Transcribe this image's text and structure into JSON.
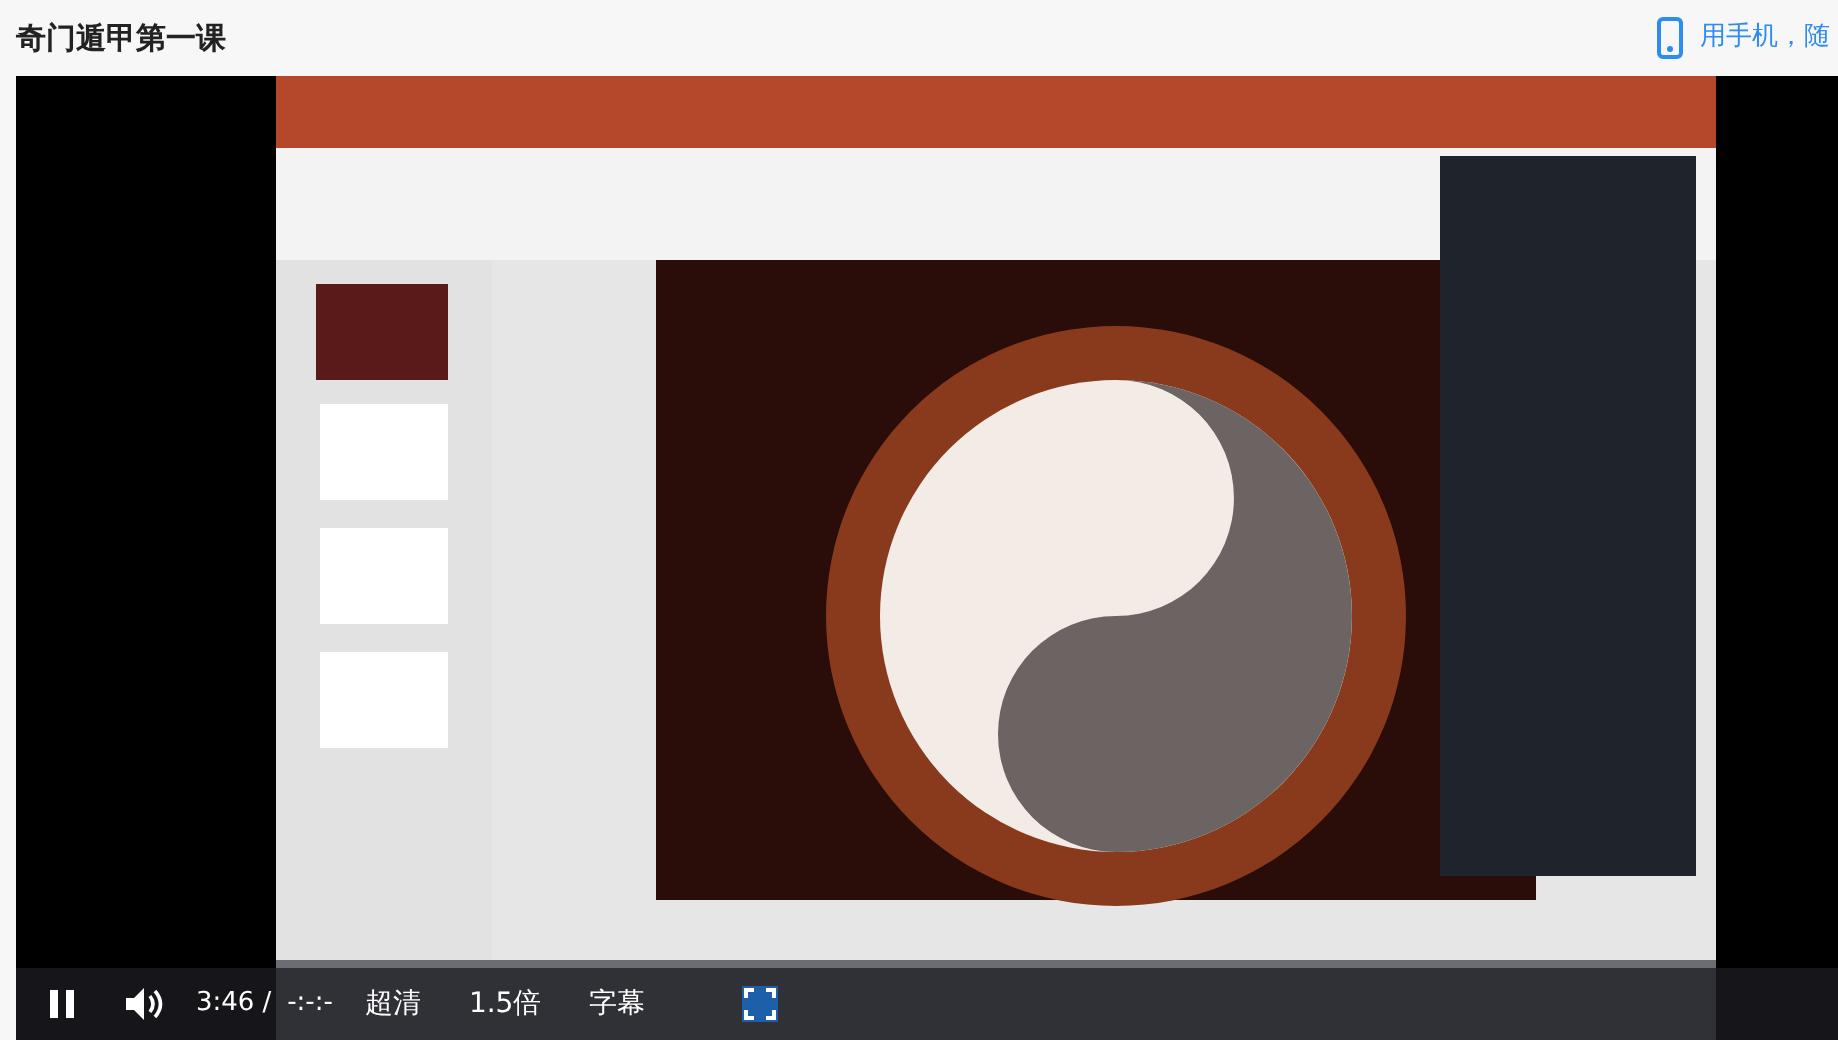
{
  "page": {
    "title": "奇门遁甲第一课",
    "mobile_link": "用手机，随"
  },
  "player": {
    "controls": {
      "playing": true,
      "current_time": "3:46",
      "separator": "/",
      "duration": "-:-:-",
      "quality": "超清",
      "speed": "1.5倍",
      "subtitles": "字幕"
    }
  }
}
